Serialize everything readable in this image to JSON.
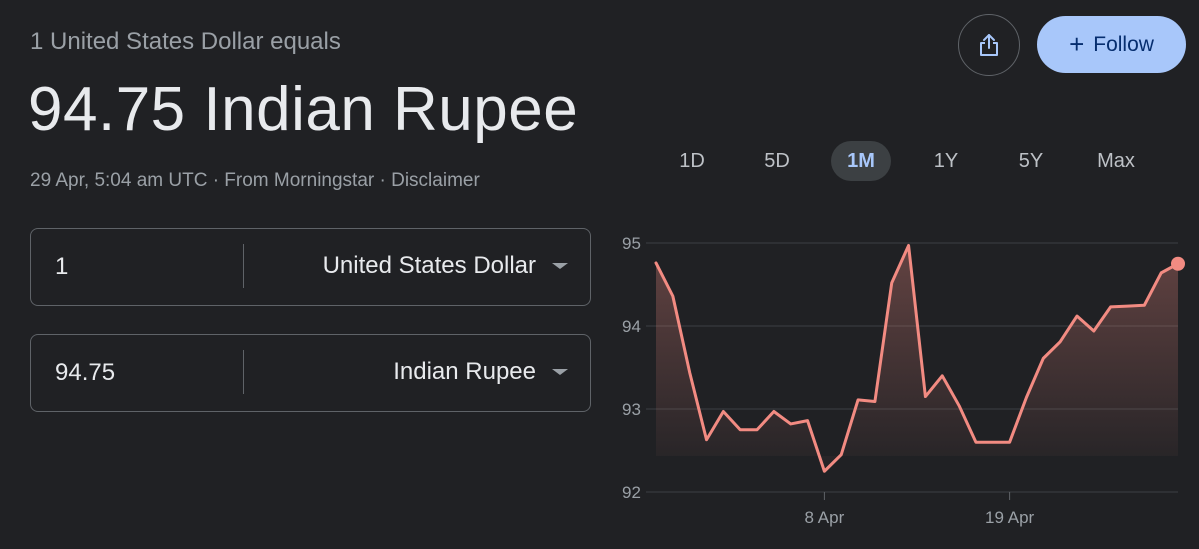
{
  "header": {
    "subtitle": "1 United States Dollar equals",
    "value": "94.75 Indian Rupee",
    "meta": "29 Apr, 5:04 am UTC · From Morningstar · Disclaimer"
  },
  "actions": {
    "share_icon": "share-icon",
    "follow_icon": "plus-icon",
    "follow_label": "Follow"
  },
  "converter": {
    "from": {
      "amount": "1",
      "currency": "United States Dollar"
    },
    "to": {
      "amount": "94.75",
      "currency": "Indian Rupee"
    }
  },
  "range_tabs": [
    {
      "label": "1D",
      "active": false
    },
    {
      "label": "5D",
      "active": false
    },
    {
      "label": "1M",
      "active": true
    },
    {
      "label": "1Y",
      "active": false
    },
    {
      "label": "5Y",
      "active": false
    },
    {
      "label": "Max",
      "active": false
    }
  ],
  "chart_data": {
    "type": "area",
    "title": "",
    "xlabel": "",
    "ylabel": "",
    "x_tick_labels": [
      "8 Apr",
      "19 Apr"
    ],
    "y_tick_labels": [
      "95",
      "94",
      "93",
      "92"
    ],
    "ylim": [
      92,
      95
    ],
    "grid": true,
    "line_color": "#f28b82",
    "series": [
      {
        "values": [
          94.76,
          94.36,
          93.44,
          92.63,
          92.97,
          92.75,
          92.75,
          92.97,
          92.82,
          92.86,
          92.25,
          92.45,
          93.11,
          93.09,
          94.52,
          94.97,
          93.15,
          93.4,
          93.04,
          92.6,
          92.6,
          92.6,
          93.14,
          93.61,
          93.81,
          94.12,
          93.94,
          94.23,
          94.24,
          94.25,
          94.64,
          94.75
        ]
      }
    ]
  }
}
